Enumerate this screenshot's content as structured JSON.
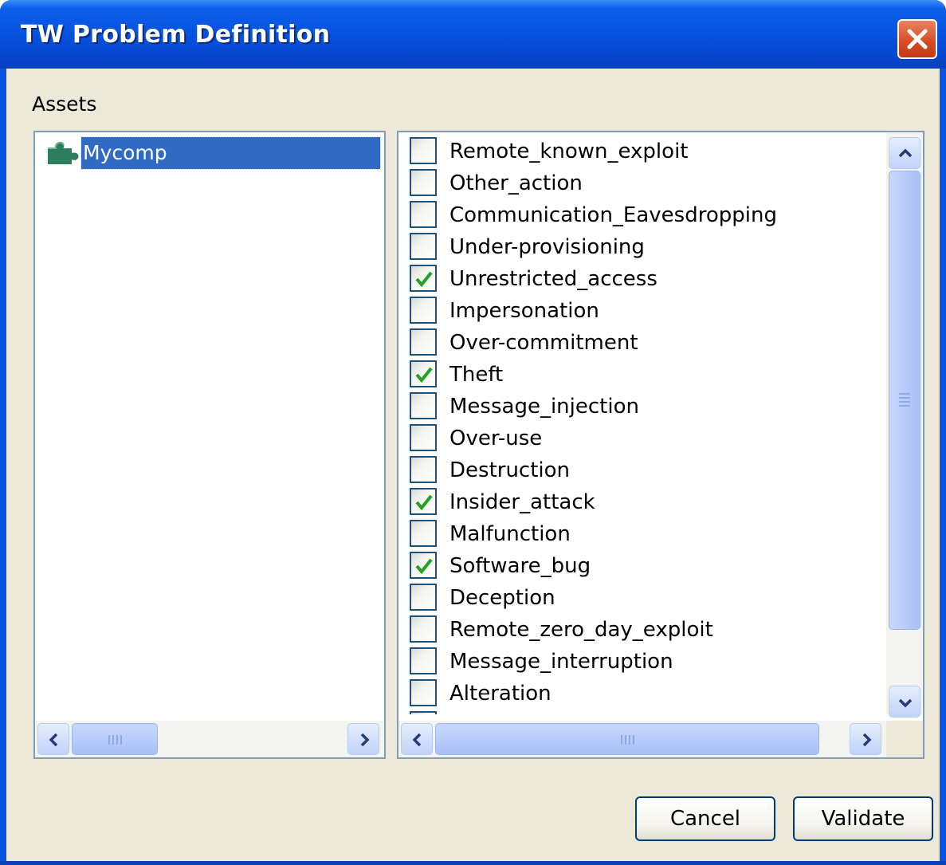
{
  "window": {
    "title": "TW Problem Definition"
  },
  "assets": {
    "label": "Assets",
    "tree": [
      {
        "label": "Mycomp",
        "selected": true
      }
    ]
  },
  "threats": [
    {
      "label": "Remote_known_exploit",
      "checked": false
    },
    {
      "label": "Other_action",
      "checked": false
    },
    {
      "label": "Communication_Eavesdropping",
      "checked": false
    },
    {
      "label": "Under-provisioning",
      "checked": false
    },
    {
      "label": "Unrestricted_access",
      "checked": true
    },
    {
      "label": "Impersonation",
      "checked": false
    },
    {
      "label": "Over-commitment",
      "checked": false
    },
    {
      "label": "Theft",
      "checked": true
    },
    {
      "label": "Message_injection",
      "checked": false
    },
    {
      "label": "Over-use",
      "checked": false
    },
    {
      "label": "Destruction",
      "checked": false
    },
    {
      "label": "Insider_attack",
      "checked": true
    },
    {
      "label": "Malfunction",
      "checked": false
    },
    {
      "label": "Software_bug",
      "checked": true
    },
    {
      "label": "Deception",
      "checked": false
    },
    {
      "label": "Remote_zero_day_exploit",
      "checked": false
    },
    {
      "label": "Message_interruption",
      "checked": false
    },
    {
      "label": "Alteration",
      "checked": false
    },
    {
      "label": "",
      "checked": false
    }
  ],
  "buttons": {
    "cancel": "Cancel",
    "validate": "Validate"
  },
  "colors": {
    "selection": "#316ac5",
    "check": "#21a121",
    "titlebar": "#0650de"
  },
  "icons": {
    "close": "close-icon",
    "tree_node": "puzzle-icon"
  }
}
